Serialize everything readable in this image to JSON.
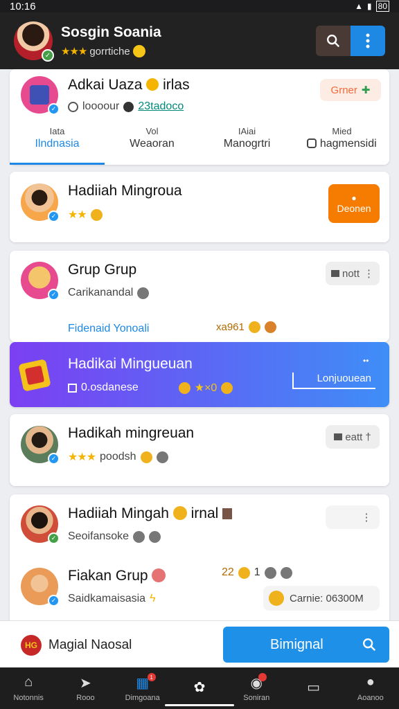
{
  "status": {
    "time": "10:16",
    "battery": "80"
  },
  "header": {
    "title": "Sosgin Soania",
    "subtitle": "gorrtiche",
    "stars": "★★★",
    "avatar_bg": "#b3202a",
    "badge_color": "#43a047"
  },
  "profile_card": {
    "name": "Adkai Uaza",
    "emoji": "😊",
    "suffix": "irlas",
    "meta_label": "loooour",
    "meta_link": "23tadoco",
    "action": "Grner",
    "action_icon": "✚",
    "tabs": [
      {
        "small": "Iata",
        "label": "Ilndnasia"
      },
      {
        "small": "Vol",
        "label": "Weaoran"
      },
      {
        "small": "IAiai",
        "label": "Manogrtri"
      },
      {
        "small": "Mied",
        "label": "hagmensidi"
      }
    ]
  },
  "items": [
    {
      "name": "Hadiiah Mingroua",
      "stars": "★★",
      "action": "Deonen",
      "action_color": "#f57c00",
      "avatar_bg": "#f7a64a"
    },
    {
      "name": "Grup Grup",
      "meta": "Carikanandal",
      "link": "Fidenaid Yonoali",
      "count": "xa961",
      "action": "nott",
      "avatar_bg": "#e84a8f"
    },
    {
      "name": "Hadikai Mingueuan",
      "meta": "0.osdanese",
      "badge": "★×0",
      "action": "Lonjuouean",
      "avatar_bg": "#f4c21b"
    },
    {
      "name": "Hadikah mingreuan",
      "stars": "★★★",
      "meta": "poodsh",
      "action": "eatt",
      "avatar_bg": "#5c7d5b"
    },
    {
      "name": "Hadiiah Mingah",
      "suffix": "irnal",
      "meta": "Seoifansoke",
      "avatar_bg": "#d04d3a"
    },
    {
      "name": "Fiakan Grup",
      "meta": "Saidkamaisasia",
      "count": "22",
      "count2": "1",
      "chip": "Carnie: 06300M",
      "avatar_bg": "#e99b57"
    }
  ],
  "bottom": {
    "label": "Magial Naosal",
    "button": "Bimignal",
    "logo": "HG"
  },
  "nav": [
    {
      "icon": "home-icon",
      "glyph": "⌂",
      "label": "Notonnis"
    },
    {
      "icon": "send-icon",
      "glyph": "➤",
      "label": "Rooo"
    },
    {
      "icon": "chat-icon",
      "glyph": "▦",
      "label": "Dimgoana",
      "badge": "1"
    },
    {
      "icon": "center-icon",
      "glyph": "✿",
      "label": ""
    },
    {
      "icon": "camera-icon",
      "glyph": "◉",
      "label": "Soniran"
    },
    {
      "icon": "tablet-icon",
      "glyph": "▭",
      "label": ""
    },
    {
      "icon": "profile-icon",
      "glyph": "●",
      "label": "Aoanoo"
    }
  ]
}
